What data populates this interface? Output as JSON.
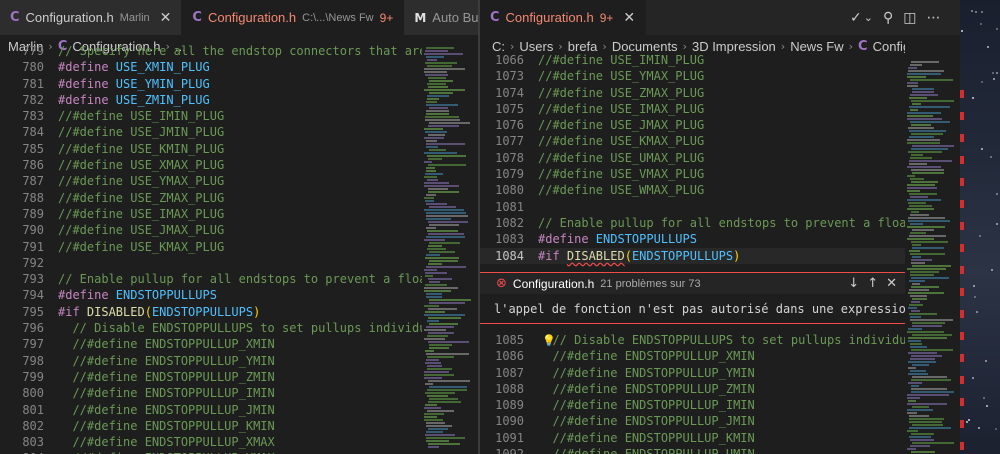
{
  "colors": {
    "editor_bg": "#1e1e1e",
    "error": "#f14c4c",
    "accent_c_icon": "#a074c4"
  },
  "left": {
    "tabs": [
      {
        "icon": "C",
        "title": "Configuration.h",
        "path": "Marlin",
        "close": "✕",
        "active": false
      },
      {
        "icon": "C",
        "title": "Configuration.h",
        "path": "C:\\...\\News Fw",
        "badge": "9+",
        "active": true
      },
      {
        "icon": "M",
        "title": "Auto Build",
        "active": false
      }
    ],
    "breadcrumb": [
      "Marlin",
      "Configuration.h",
      "..."
    ],
    "lines": [
      {
        "n": "779",
        "parts": [
          [
            "cmt",
            "// Specify here all the endstop connectors that are conn"
          ]
        ]
      },
      {
        "n": "780",
        "parts": [
          [
            "macro",
            "#define "
          ],
          [
            "ident",
            "USE_XMIN_PLUG"
          ]
        ]
      },
      {
        "n": "781",
        "parts": [
          [
            "macro",
            "#define "
          ],
          [
            "ident",
            "USE_YMIN_PLUG"
          ]
        ]
      },
      {
        "n": "782",
        "parts": [
          [
            "macro",
            "#define "
          ],
          [
            "ident",
            "USE_ZMIN_PLUG"
          ]
        ]
      },
      {
        "n": "783",
        "parts": [
          [
            "cmt",
            "//#define USE_IMIN_PLUG"
          ]
        ]
      },
      {
        "n": "784",
        "parts": [
          [
            "cmt",
            "//#define USE_JMIN_PLUG"
          ]
        ]
      },
      {
        "n": "785",
        "parts": [
          [
            "cmt",
            "//#define USE_KMIN_PLUG"
          ]
        ]
      },
      {
        "n": "786",
        "parts": [
          [
            "cmt",
            "//#define USE_XMAX_PLUG"
          ]
        ]
      },
      {
        "n": "787",
        "parts": [
          [
            "cmt",
            "//#define USE_YMAX_PLUG"
          ]
        ]
      },
      {
        "n": "788",
        "parts": [
          [
            "cmt",
            "//#define USE_ZMAX_PLUG"
          ]
        ]
      },
      {
        "n": "789",
        "parts": [
          [
            "cmt",
            "//#define USE_IMAX_PLUG"
          ]
        ]
      },
      {
        "n": "790",
        "parts": [
          [
            "cmt",
            "//#define USE_JMAX_PLUG"
          ]
        ]
      },
      {
        "n": "791",
        "parts": [
          [
            "cmt",
            "//#define USE_KMAX_PLUG"
          ]
        ]
      },
      {
        "n": "792",
        "parts": []
      },
      {
        "n": "793",
        "parts": [
          [
            "cmt",
            "// Enable pullup for all endstops to prevent a floating"
          ]
        ]
      },
      {
        "n": "794",
        "parts": [
          [
            "macro",
            "#define "
          ],
          [
            "ident",
            "ENDSTOPPULLUPS"
          ]
        ]
      },
      {
        "n": "795",
        "parts": [
          [
            "macro",
            "#if "
          ],
          [
            "fn",
            "DISABLED"
          ],
          [
            "brace",
            "("
          ],
          [
            "ident",
            "ENDSTOPPULLUPS"
          ],
          [
            "brace",
            ")"
          ]
        ]
      },
      {
        "n": "796",
        "parts": [
          [
            "cmt",
            "  // Disable ENDSTOPPULLUPS to set pullups individually"
          ]
        ]
      },
      {
        "n": "797",
        "parts": [
          [
            "cmt",
            "  //#define ENDSTOPPULLUP_XMIN"
          ]
        ]
      },
      {
        "n": "798",
        "parts": [
          [
            "cmt",
            "  //#define ENDSTOPPULLUP_YMIN"
          ]
        ]
      },
      {
        "n": "799",
        "parts": [
          [
            "cmt",
            "  //#define ENDSTOPPULLUP_ZMIN"
          ]
        ]
      },
      {
        "n": "800",
        "parts": [
          [
            "cmt",
            "  //#define ENDSTOPPULLUP_IMIN"
          ]
        ]
      },
      {
        "n": "801",
        "parts": [
          [
            "cmt",
            "  //#define ENDSTOPPULLUP_JMIN"
          ]
        ]
      },
      {
        "n": "802",
        "parts": [
          [
            "cmt",
            "  //#define ENDSTOPPULLUP_KMIN"
          ]
        ]
      },
      {
        "n": "803",
        "parts": [
          [
            "cmt",
            "  //#define ENDSTOPPULLUP_XMAX"
          ]
        ]
      },
      {
        "n": "804",
        "parts": [
          [
            "cmt",
            "  //#define ENDSTOPPULLUP_YMAX"
          ]
        ]
      }
    ]
  },
  "right": {
    "tab": {
      "icon": "C",
      "title": "Configuration.h",
      "badge": "9+",
      "close": "✕"
    },
    "actions": [
      "✓",
      "⌄",
      "⚲",
      "◫",
      "⋯"
    ],
    "breadcrumb": [
      "C:",
      "Users",
      "brefa",
      "Documents",
      "3D Impression",
      "News Fw",
      "Configuration.h",
      "..."
    ],
    "lines_top": [
      {
        "n": "1066",
        "parts": [
          [
            "cmt",
            "//#define USE_IMIN_PLUG"
          ]
        ]
      },
      {
        "n": "1073",
        "parts": [
          [
            "cmt",
            "//#define USE_YMAX_PLUG"
          ]
        ]
      },
      {
        "n": "1074",
        "parts": [
          [
            "cmt",
            "//#define USE_ZMAX_PLUG"
          ]
        ]
      },
      {
        "n": "1075",
        "parts": [
          [
            "cmt",
            "//#define USE_IMAX_PLUG"
          ]
        ]
      },
      {
        "n": "1076",
        "parts": [
          [
            "cmt",
            "//#define USE_JMAX_PLUG"
          ]
        ]
      },
      {
        "n": "1077",
        "parts": [
          [
            "cmt",
            "//#define USE_KMAX_PLUG"
          ]
        ]
      },
      {
        "n": "1078",
        "parts": [
          [
            "cmt",
            "//#define USE_UMAX_PLUG"
          ]
        ]
      },
      {
        "n": "1079",
        "parts": [
          [
            "cmt",
            "//#define USE_VMAX_PLUG"
          ]
        ]
      },
      {
        "n": "1080",
        "parts": [
          [
            "cmt",
            "//#define USE_WMAX_PLUG"
          ]
        ]
      },
      {
        "n": "1081",
        "parts": []
      },
      {
        "n": "1082",
        "parts": [
          [
            "cmt",
            "// Enable pullup for all endstops to prevent a floating"
          ]
        ]
      },
      {
        "n": "1083",
        "parts": [
          [
            "macro",
            "#define "
          ],
          [
            "ident",
            "ENDSTOPPULLUPS"
          ]
        ]
      },
      {
        "n": "1084",
        "current": true,
        "parts": [
          [
            "macro",
            "#if "
          ],
          [
            "fn-sq",
            "DISABLED"
          ],
          [
            "brace",
            "("
          ],
          [
            "ident",
            "ENDSTOPPULLUPS"
          ],
          [
            "brace",
            ")"
          ]
        ]
      }
    ],
    "peek": {
      "title": "Configuration.h",
      "count": "21 problèmes sur 73",
      "message": "l'appel de fonction n'est pas autorisé dans une expression cons"
    },
    "lines_bot": [
      {
        "n": "1085",
        "bulb": true,
        "parts": [
          [
            "cmt",
            "  // Disable ENDSTOPPULLUPS to set pullups individually"
          ]
        ]
      },
      {
        "n": "1086",
        "parts": [
          [
            "cmt",
            "  //#define ENDSTOPPULLUP_XMIN"
          ]
        ]
      },
      {
        "n": "1087",
        "parts": [
          [
            "cmt",
            "  //#define ENDSTOPPULLUP_YMIN"
          ]
        ]
      },
      {
        "n": "1088",
        "parts": [
          [
            "cmt",
            "  //#define ENDSTOPPULLUP_ZMIN"
          ]
        ]
      },
      {
        "n": "1089",
        "parts": [
          [
            "cmt",
            "  //#define ENDSTOPPULLUP_IMIN"
          ]
        ]
      },
      {
        "n": "1090",
        "parts": [
          [
            "cmt",
            "  //#define ENDSTOPPULLUP_JMIN"
          ]
        ]
      },
      {
        "n": "1091",
        "parts": [
          [
            "cmt",
            "  //#define ENDSTOPPULLUP_KMIN"
          ]
        ]
      },
      {
        "n": "1092",
        "parts": [
          [
            "cmt",
            "  //#define ENDSTOPPULLUP_UMIN"
          ]
        ]
      }
    ]
  }
}
